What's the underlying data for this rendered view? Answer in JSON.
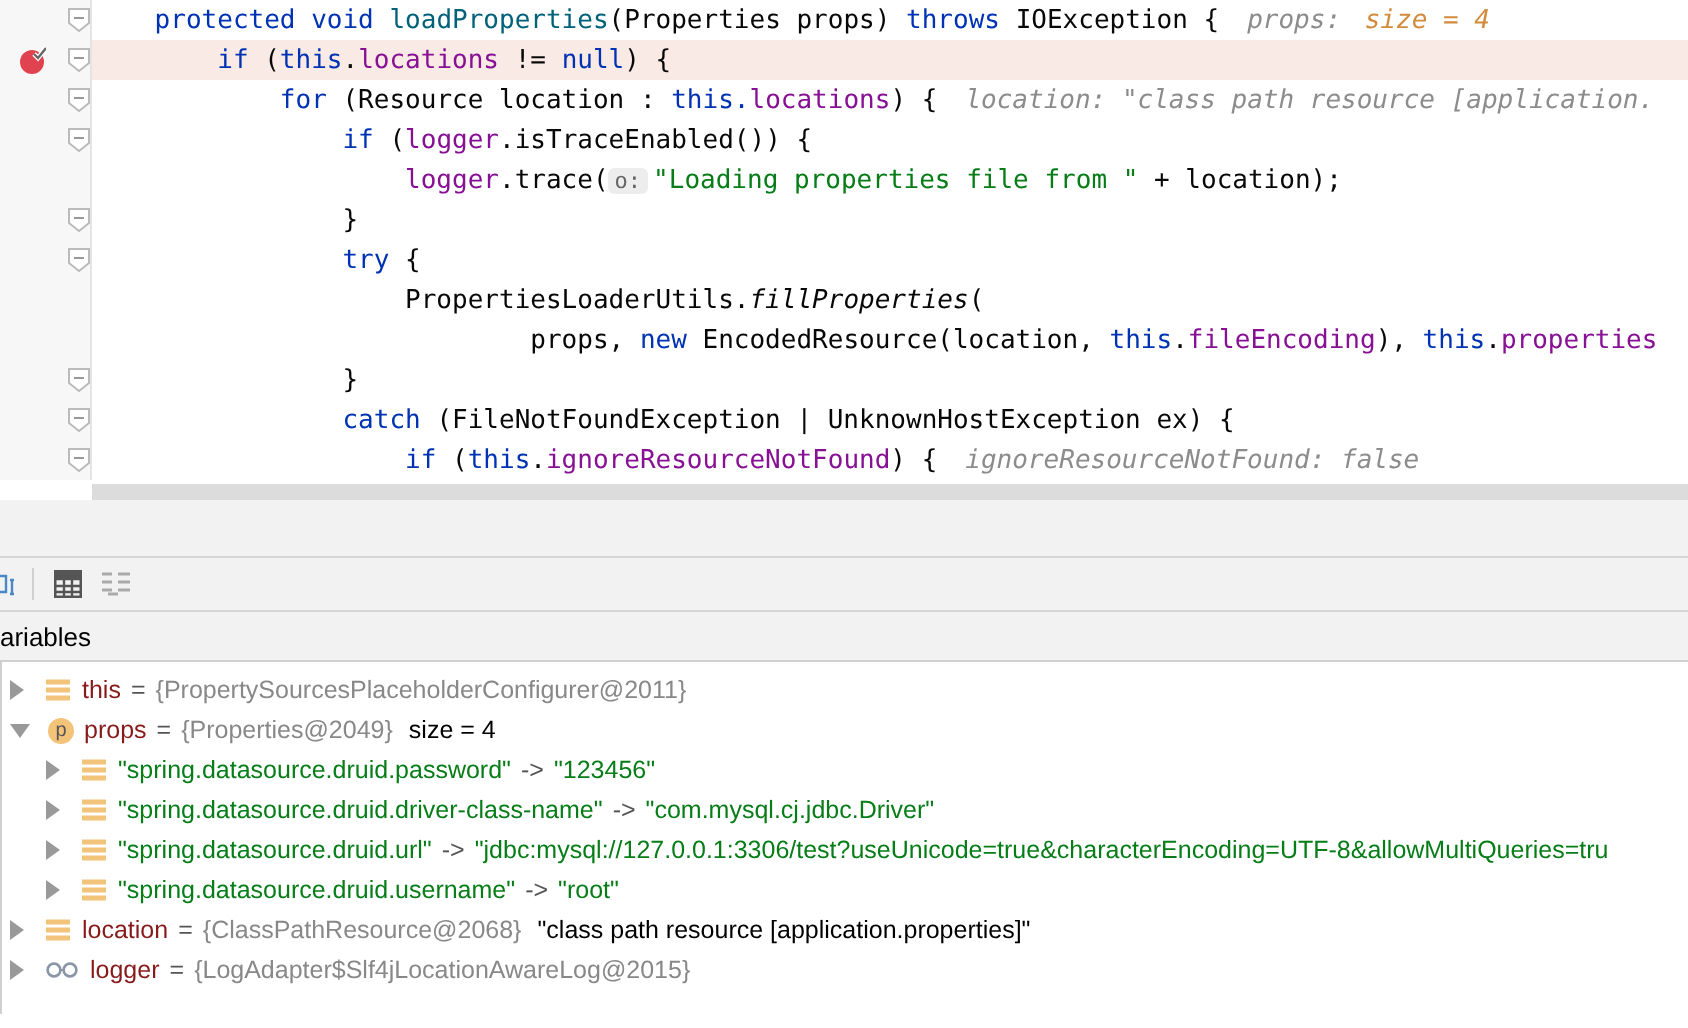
{
  "editor": {
    "lines": [
      {
        "highlighted": false,
        "breakpoint": false,
        "fold": true,
        "tokens": [
          {
            "kind": "kw",
            "text": "    protected void "
          },
          {
            "kind": "decl",
            "text": "loadProperties"
          },
          {
            "kind": "txt",
            "text": "(Properties props) "
          },
          {
            "kind": "kw",
            "text": "throws "
          },
          {
            "kind": "txt",
            "text": "IOException {"
          },
          {
            "kind": "hint",
            "text": "props: "
          },
          {
            "kind": "hintval",
            "text": "size = 4"
          }
        ]
      },
      {
        "highlighted": true,
        "breakpoint": true,
        "fold": true,
        "tokens": [
          {
            "kind": "kw",
            "text": "        if "
          },
          {
            "kind": "txt",
            "text": "("
          },
          {
            "kind": "kw",
            "text": "this"
          },
          {
            "kind": "txt",
            "text": "."
          },
          {
            "kind": "field",
            "text": "locations"
          },
          {
            "kind": "txt",
            "text": " != "
          },
          {
            "kind": "kw",
            "text": "null"
          },
          {
            "kind": "txt",
            "text": ") {"
          }
        ]
      },
      {
        "highlighted": false,
        "breakpoint": false,
        "fold": true,
        "tokens": [
          {
            "kind": "kw",
            "text": "            for "
          },
          {
            "kind": "txt",
            "text": "(Resource location : "
          },
          {
            "kind": "kw",
            "text": "this."
          },
          {
            "kind": "field",
            "text": "locations"
          },
          {
            "kind": "txt",
            "text": ") {"
          },
          {
            "kind": "hint",
            "text": "location: \"class path resource [application."
          }
        ]
      },
      {
        "highlighted": false,
        "breakpoint": false,
        "fold": true,
        "tokens": [
          {
            "kind": "kw",
            "text": "                if "
          },
          {
            "kind": "txt",
            "text": "("
          },
          {
            "kind": "field",
            "text": "logger"
          },
          {
            "kind": "txt",
            "text": ".isTraceEnabled()) {"
          }
        ]
      },
      {
        "highlighted": false,
        "breakpoint": false,
        "fold": false,
        "tokens": [
          {
            "kind": "field",
            "text": "                    logger"
          },
          {
            "kind": "txt",
            "text": ".trace("
          },
          {
            "kind": "param",
            "text": "o:"
          },
          {
            "kind": "str",
            "text": "\"Loading properties file from \""
          },
          {
            "kind": "txt",
            "text": " + location);"
          }
        ]
      },
      {
        "highlighted": false,
        "breakpoint": false,
        "fold": true,
        "tokens": [
          {
            "kind": "txt",
            "text": "                }"
          }
        ]
      },
      {
        "highlighted": false,
        "breakpoint": false,
        "fold": true,
        "tokens": [
          {
            "kind": "kw",
            "text": "                try "
          },
          {
            "kind": "txt",
            "text": "{"
          }
        ]
      },
      {
        "highlighted": false,
        "breakpoint": false,
        "fold": false,
        "tokens": [
          {
            "kind": "txt",
            "text": "                    PropertiesLoaderUtils."
          },
          {
            "kind": "call",
            "text": "fillProperties"
          },
          {
            "kind": "txt",
            "text": "("
          }
        ]
      },
      {
        "highlighted": false,
        "breakpoint": false,
        "fold": false,
        "tokens": [
          {
            "kind": "txt",
            "text": "                            props, "
          },
          {
            "kind": "kw",
            "text": "new "
          },
          {
            "kind": "txt",
            "text": "EncodedResource(location, "
          },
          {
            "kind": "kw",
            "text": "this"
          },
          {
            "kind": "txt",
            "text": "."
          },
          {
            "kind": "field",
            "text": "fileEncoding"
          },
          {
            "kind": "txt",
            "text": "), "
          },
          {
            "kind": "kw",
            "text": "this"
          },
          {
            "kind": "txt",
            "text": "."
          },
          {
            "kind": "field",
            "text": "properties"
          }
        ]
      },
      {
        "highlighted": false,
        "breakpoint": false,
        "fold": true,
        "tokens": [
          {
            "kind": "txt",
            "text": "                }"
          }
        ]
      },
      {
        "highlighted": false,
        "breakpoint": false,
        "fold": true,
        "tokens": [
          {
            "kind": "kw",
            "text": "                catch "
          },
          {
            "kind": "txt",
            "text": "(FileNotFoundException | UnknownHostException ex) {"
          }
        ]
      },
      {
        "highlighted": false,
        "breakpoint": false,
        "fold": true,
        "tokens": [
          {
            "kind": "kw",
            "text": "                    if "
          },
          {
            "kind": "txt",
            "text": "("
          },
          {
            "kind": "kw",
            "text": "this"
          },
          {
            "kind": "txt",
            "text": "."
          },
          {
            "kind": "field",
            "text": "ignoreResourceNotFound"
          },
          {
            "kind": "txt",
            "text": ") {"
          },
          {
            "kind": "hint",
            "text": "ignoreResourceNotFound: false"
          }
        ]
      }
    ]
  },
  "variables": {
    "title": "ariables",
    "tree": [
      {
        "kind": "field",
        "name": "this",
        "sep": "=",
        "value": "{PropertySourcesPlaceholderConfigurer@2011}",
        "expanded": false
      },
      {
        "kind": "param",
        "badge": "p",
        "name": "props",
        "sep": "=",
        "value": "{Properties@2049}",
        "extra": "size = 4",
        "expanded": true,
        "children": [
          {
            "kind": "field",
            "name": "\"spring.datasource.druid.password\"",
            "sep": "->",
            "value": "\"123456\"",
            "expanded": false
          },
          {
            "kind": "field",
            "name": "\"spring.datasource.druid.driver-class-name\"",
            "sep": "->",
            "value": "\"com.mysql.cj.jdbc.Driver\"",
            "expanded": false
          },
          {
            "kind": "field",
            "name": "\"spring.datasource.druid.url\"",
            "sep": "->",
            "value": "\"jdbc:mysql://127.0.0.1:3306/test?useUnicode=true&characterEncoding=UTF-8&allowMultiQueries=tru",
            "expanded": false
          },
          {
            "kind": "field",
            "name": "\"spring.datasource.druid.username\"",
            "sep": "->",
            "value": "\"root\"",
            "expanded": false
          }
        ]
      },
      {
        "kind": "field",
        "name": "location",
        "sep": "=",
        "value": "{ClassPathResource@2068}",
        "extra": "\"class path resource [application.properties]\"",
        "expanded": false
      },
      {
        "kind": "watch",
        "name": "logger",
        "sep": "=",
        "value": "{LogAdapter$Slf4jLocationAwareLog@2015}",
        "expanded": false
      }
    ]
  }
}
